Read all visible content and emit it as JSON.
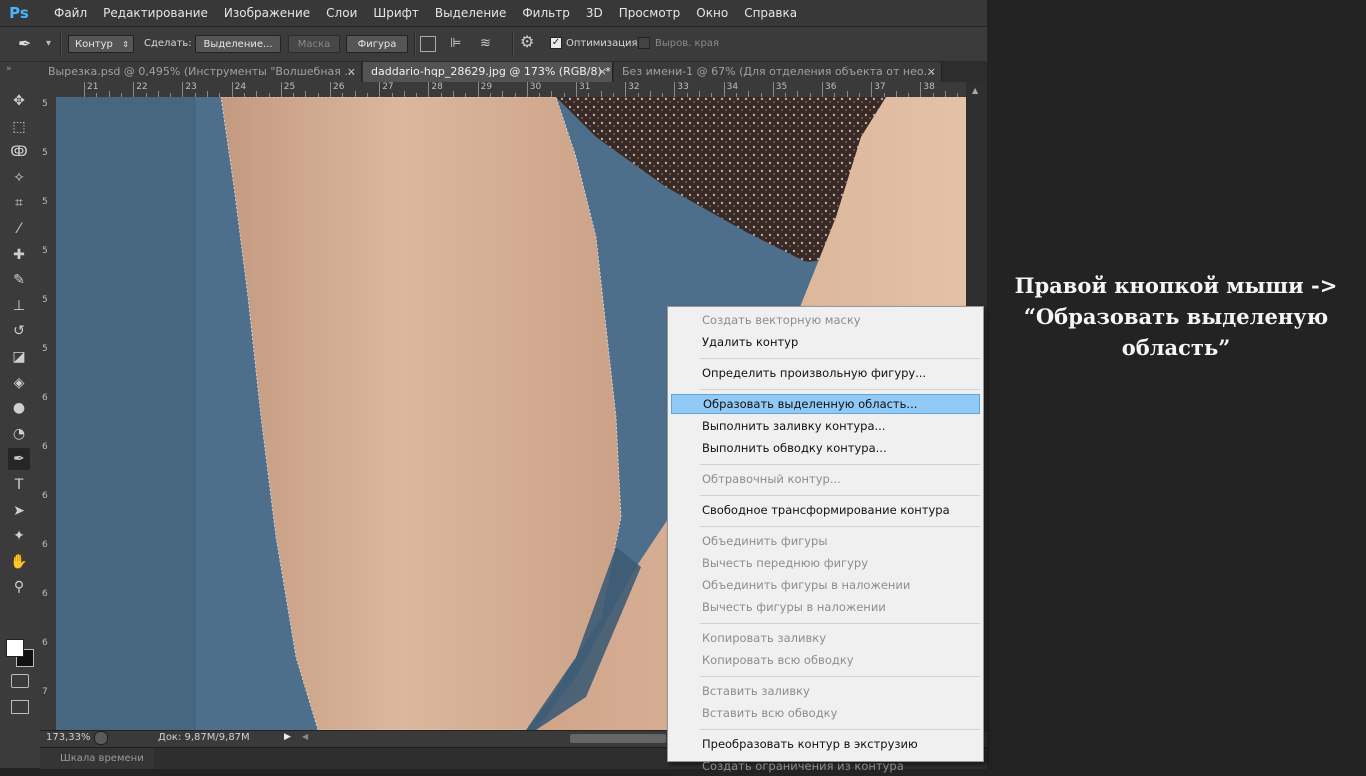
{
  "app": {
    "logo": "Ps"
  },
  "menu": [
    "Файл",
    "Редактирование",
    "Изображение",
    "Слои",
    "Шрифт",
    "Выделение",
    "Фильтр",
    "3D",
    "Просмотр",
    "Окно",
    "Справка"
  ],
  "options": {
    "mode": "Контур",
    "make_label": "Сделать:",
    "selection_btn": "Выделение...",
    "mask_btn": "Маска",
    "shape_btn": "Фигура",
    "optimize_label": "Оптимизация",
    "align_label": "Выров. края",
    "optimize_checked": true,
    "align_checked": false
  },
  "tabs": [
    {
      "title": "Вырезка.psd @ 0,495% (Инструменты \"Волшебная ...",
      "close": "×",
      "active": false
    },
    {
      "title": "daddario-hqp_28629.jpg @ 173% (RGB/8) *",
      "close": "×",
      "active": true
    },
    {
      "title": "Без имени-1 @ 67% (Для отделения объекта от нео...",
      "close": "×",
      "active": false
    }
  ],
  "ruler": {
    "top": [
      "21",
      "22",
      "23",
      "24",
      "25",
      "26",
      "27",
      "28",
      "29",
      "30",
      "31",
      "32",
      "33",
      "34",
      "35",
      "36",
      "37",
      "38"
    ],
    "left": [
      "5",
      "5",
      "5",
      "5",
      "5",
      "5",
      "6",
      "6",
      "6",
      "6",
      "6",
      "6",
      "7",
      "7"
    ]
  },
  "status": {
    "zoom": "173,33%",
    "doc": "Док: 9,87M/9,87M"
  },
  "timeline": {
    "label": "Шкала времени"
  },
  "context_menu": [
    {
      "label": "Создать векторную маску",
      "disabled": true
    },
    {
      "label": "Удалить контур",
      "disabled": false
    },
    {
      "sep": true
    },
    {
      "label": "Определить произвольную фигуру...",
      "disabled": false
    },
    {
      "sep": true
    },
    {
      "label": "Образовать выделенную область...",
      "disabled": false,
      "highlighted": true
    },
    {
      "label": "Выполнить заливку контура...",
      "disabled": false
    },
    {
      "label": "Выполнить обводку контура...",
      "disabled": false
    },
    {
      "sep": true
    },
    {
      "label": "Обтравочный контур...",
      "disabled": true
    },
    {
      "sep": true
    },
    {
      "label": "Свободное трансформирование контура",
      "disabled": false
    },
    {
      "sep": true
    },
    {
      "label": "Объединить фигуры",
      "disabled": true
    },
    {
      "label": "Вычесть переднюю фигуру",
      "disabled": true
    },
    {
      "label": "Объединить фигуры в наложении",
      "disabled": true
    },
    {
      "label": "Вычесть фигуры в наложении",
      "disabled": true
    },
    {
      "sep": true
    },
    {
      "label": "Копировать заливку",
      "disabled": true
    },
    {
      "label": "Копировать всю обводку",
      "disabled": true
    },
    {
      "sep": true
    },
    {
      "label": "Вставить заливку",
      "disabled": true
    },
    {
      "label": "Вставить всю обводку",
      "disabled": true
    },
    {
      "sep": true
    },
    {
      "label": "Преобразовать контур в экструзию",
      "disabled": false
    },
    {
      "label": "Создать ограничения из контура",
      "disabled": true
    }
  ],
  "caption": {
    "line1": "Правой кнопкой мыши ->",
    "line2": "“Образовать выделеную",
    "line3": "область”"
  },
  "colors": {
    "accent": "#4bb4ff",
    "highlight": "#91c9f7",
    "canvas_bg": "#4d6f8b",
    "skin": "#d9b398"
  },
  "tool_icons": [
    "move-icon",
    "marquee-icon",
    "lasso-icon",
    "magic-wand-icon",
    "crop-icon",
    "eyedropper-icon",
    "healing-brush-icon",
    "brush-icon",
    "clone-stamp-icon",
    "history-brush-icon",
    "eraser-icon",
    "paint-bucket-icon",
    "blur-icon",
    "dodge-icon",
    "pen-icon",
    "type-icon",
    "path-selection-icon",
    "shape-icon",
    "hand-icon",
    "zoom-icon"
  ]
}
